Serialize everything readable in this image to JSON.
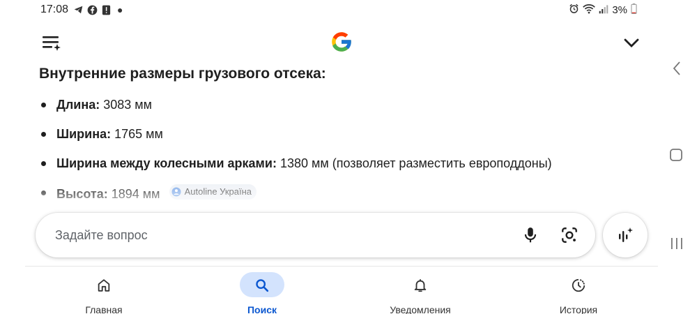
{
  "status_bar": {
    "time": "17:08",
    "battery": "3%",
    "left_icons": [
      "telegram-icon",
      "facebook-icon",
      "alert-icon"
    ],
    "right_icons": [
      "alarm-icon",
      "wifi-icon",
      "signal-icon",
      "battery-icon"
    ]
  },
  "app_bar": {
    "menu_icon": "history-menu-icon",
    "logo": "google-logo",
    "chevron_icon": "chevron-down-icon"
  },
  "content": {
    "heading": "Внутренние размеры грузового отсека:",
    "facts": [
      {
        "label": "Длина:",
        "value": "3083 мм"
      },
      {
        "label": "Ширина:",
        "value": "1765 мм"
      },
      {
        "label": "Ширина между колесными арками:",
        "value": "1380 мм (позволяет разместить европоддоны)"
      },
      {
        "label": "Высота:",
        "value": "1894 мм",
        "source": "Autoline Україна"
      }
    ]
  },
  "search": {
    "placeholder": "Задайте вопрос",
    "mic_icon": "mic-icon",
    "lens_icon": "lens-icon",
    "ai_icon": "ai-mode-icon"
  },
  "bottom_nav": {
    "items": [
      {
        "label": "Главная",
        "icon": "home-icon",
        "active": false
      },
      {
        "label": "Поиск",
        "icon": "search-icon",
        "active": true
      },
      {
        "label": "Уведомления",
        "icon": "bell-icon",
        "active": false
      },
      {
        "label": "История",
        "icon": "history-icon",
        "active": false
      }
    ]
  },
  "colors": {
    "accent": "#0b57d0",
    "active_pill": "#d3e3fd",
    "text": "#1f1f1f",
    "placeholder": "#5f6368"
  }
}
